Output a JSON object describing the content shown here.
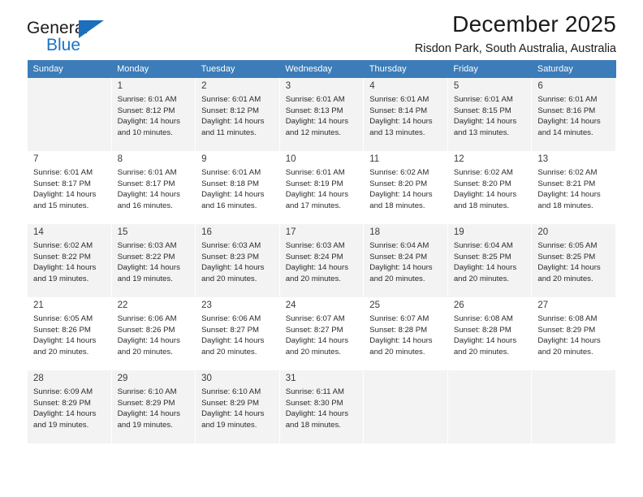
{
  "brand": {
    "general": "General",
    "blue": "Blue",
    "flag_color": "#1c6fbc"
  },
  "header": {
    "month_title": "December 2025",
    "location": "Risdon Park, South Australia, Australia",
    "header_bg": "#3b7cb9"
  },
  "weekday_headers": [
    "Sunday",
    "Monday",
    "Tuesday",
    "Wednesday",
    "Thursday",
    "Friday",
    "Saturday"
  ],
  "weeks": [
    {
      "shaded": true,
      "days": [
        {
          "num": "",
          "sunrise": "",
          "sunset": "",
          "daylight_1": "",
          "daylight_2": ""
        },
        {
          "num": "1",
          "sunrise": "Sunrise: 6:01 AM",
          "sunset": "Sunset: 8:12 PM",
          "daylight_1": "Daylight: 14 hours",
          "daylight_2": "and 10 minutes."
        },
        {
          "num": "2",
          "sunrise": "Sunrise: 6:01 AM",
          "sunset": "Sunset: 8:12 PM",
          "daylight_1": "Daylight: 14 hours",
          "daylight_2": "and 11 minutes."
        },
        {
          "num": "3",
          "sunrise": "Sunrise: 6:01 AM",
          "sunset": "Sunset: 8:13 PM",
          "daylight_1": "Daylight: 14 hours",
          "daylight_2": "and 12 minutes."
        },
        {
          "num": "4",
          "sunrise": "Sunrise: 6:01 AM",
          "sunset": "Sunset: 8:14 PM",
          "daylight_1": "Daylight: 14 hours",
          "daylight_2": "and 13 minutes."
        },
        {
          "num": "5",
          "sunrise": "Sunrise: 6:01 AM",
          "sunset": "Sunset: 8:15 PM",
          "daylight_1": "Daylight: 14 hours",
          "daylight_2": "and 13 minutes."
        },
        {
          "num": "6",
          "sunrise": "Sunrise: 6:01 AM",
          "sunset": "Sunset: 8:16 PM",
          "daylight_1": "Daylight: 14 hours",
          "daylight_2": "and 14 minutes."
        }
      ]
    },
    {
      "shaded": false,
      "days": [
        {
          "num": "7",
          "sunrise": "Sunrise: 6:01 AM",
          "sunset": "Sunset: 8:17 PM",
          "daylight_1": "Daylight: 14 hours",
          "daylight_2": "and 15 minutes."
        },
        {
          "num": "8",
          "sunrise": "Sunrise: 6:01 AM",
          "sunset": "Sunset: 8:17 PM",
          "daylight_1": "Daylight: 14 hours",
          "daylight_2": "and 16 minutes."
        },
        {
          "num": "9",
          "sunrise": "Sunrise: 6:01 AM",
          "sunset": "Sunset: 8:18 PM",
          "daylight_1": "Daylight: 14 hours",
          "daylight_2": "and 16 minutes."
        },
        {
          "num": "10",
          "sunrise": "Sunrise: 6:01 AM",
          "sunset": "Sunset: 8:19 PM",
          "daylight_1": "Daylight: 14 hours",
          "daylight_2": "and 17 minutes."
        },
        {
          "num": "11",
          "sunrise": "Sunrise: 6:02 AM",
          "sunset": "Sunset: 8:20 PM",
          "daylight_1": "Daylight: 14 hours",
          "daylight_2": "and 18 minutes."
        },
        {
          "num": "12",
          "sunrise": "Sunrise: 6:02 AM",
          "sunset": "Sunset: 8:20 PM",
          "daylight_1": "Daylight: 14 hours",
          "daylight_2": "and 18 minutes."
        },
        {
          "num": "13",
          "sunrise": "Sunrise: 6:02 AM",
          "sunset": "Sunset: 8:21 PM",
          "daylight_1": "Daylight: 14 hours",
          "daylight_2": "and 18 minutes."
        }
      ]
    },
    {
      "shaded": true,
      "days": [
        {
          "num": "14",
          "sunrise": "Sunrise: 6:02 AM",
          "sunset": "Sunset: 8:22 PM",
          "daylight_1": "Daylight: 14 hours",
          "daylight_2": "and 19 minutes."
        },
        {
          "num": "15",
          "sunrise": "Sunrise: 6:03 AM",
          "sunset": "Sunset: 8:22 PM",
          "daylight_1": "Daylight: 14 hours",
          "daylight_2": "and 19 minutes."
        },
        {
          "num": "16",
          "sunrise": "Sunrise: 6:03 AM",
          "sunset": "Sunset: 8:23 PM",
          "daylight_1": "Daylight: 14 hours",
          "daylight_2": "and 20 minutes."
        },
        {
          "num": "17",
          "sunrise": "Sunrise: 6:03 AM",
          "sunset": "Sunset: 8:24 PM",
          "daylight_1": "Daylight: 14 hours",
          "daylight_2": "and 20 minutes."
        },
        {
          "num": "18",
          "sunrise": "Sunrise: 6:04 AM",
          "sunset": "Sunset: 8:24 PM",
          "daylight_1": "Daylight: 14 hours",
          "daylight_2": "and 20 minutes."
        },
        {
          "num": "19",
          "sunrise": "Sunrise: 6:04 AM",
          "sunset": "Sunset: 8:25 PM",
          "daylight_1": "Daylight: 14 hours",
          "daylight_2": "and 20 minutes."
        },
        {
          "num": "20",
          "sunrise": "Sunrise: 6:05 AM",
          "sunset": "Sunset: 8:25 PM",
          "daylight_1": "Daylight: 14 hours",
          "daylight_2": "and 20 minutes."
        }
      ]
    },
    {
      "shaded": false,
      "days": [
        {
          "num": "21",
          "sunrise": "Sunrise: 6:05 AM",
          "sunset": "Sunset: 8:26 PM",
          "daylight_1": "Daylight: 14 hours",
          "daylight_2": "and 20 minutes."
        },
        {
          "num": "22",
          "sunrise": "Sunrise: 6:06 AM",
          "sunset": "Sunset: 8:26 PM",
          "daylight_1": "Daylight: 14 hours",
          "daylight_2": "and 20 minutes."
        },
        {
          "num": "23",
          "sunrise": "Sunrise: 6:06 AM",
          "sunset": "Sunset: 8:27 PM",
          "daylight_1": "Daylight: 14 hours",
          "daylight_2": "and 20 minutes."
        },
        {
          "num": "24",
          "sunrise": "Sunrise: 6:07 AM",
          "sunset": "Sunset: 8:27 PM",
          "daylight_1": "Daylight: 14 hours",
          "daylight_2": "and 20 minutes."
        },
        {
          "num": "25",
          "sunrise": "Sunrise: 6:07 AM",
          "sunset": "Sunset: 8:28 PM",
          "daylight_1": "Daylight: 14 hours",
          "daylight_2": "and 20 minutes."
        },
        {
          "num": "26",
          "sunrise": "Sunrise: 6:08 AM",
          "sunset": "Sunset: 8:28 PM",
          "daylight_1": "Daylight: 14 hours",
          "daylight_2": "and 20 minutes."
        },
        {
          "num": "27",
          "sunrise": "Sunrise: 6:08 AM",
          "sunset": "Sunset: 8:29 PM",
          "daylight_1": "Daylight: 14 hours",
          "daylight_2": "and 20 minutes."
        }
      ]
    },
    {
      "shaded": true,
      "days": [
        {
          "num": "28",
          "sunrise": "Sunrise: 6:09 AM",
          "sunset": "Sunset: 8:29 PM",
          "daylight_1": "Daylight: 14 hours",
          "daylight_2": "and 19 minutes."
        },
        {
          "num": "29",
          "sunrise": "Sunrise: 6:10 AM",
          "sunset": "Sunset: 8:29 PM",
          "daylight_1": "Daylight: 14 hours",
          "daylight_2": "and 19 minutes."
        },
        {
          "num": "30",
          "sunrise": "Sunrise: 6:10 AM",
          "sunset": "Sunset: 8:29 PM",
          "daylight_1": "Daylight: 14 hours",
          "daylight_2": "and 19 minutes."
        },
        {
          "num": "31",
          "sunrise": "Sunrise: 6:11 AM",
          "sunset": "Sunset: 8:30 PM",
          "daylight_1": "Daylight: 14 hours",
          "daylight_2": "and 18 minutes."
        },
        {
          "num": "",
          "sunrise": "",
          "sunset": "",
          "daylight_1": "",
          "daylight_2": ""
        },
        {
          "num": "",
          "sunrise": "",
          "sunset": "",
          "daylight_1": "",
          "daylight_2": ""
        },
        {
          "num": "",
          "sunrise": "",
          "sunset": "",
          "daylight_1": "",
          "daylight_2": ""
        }
      ]
    }
  ]
}
